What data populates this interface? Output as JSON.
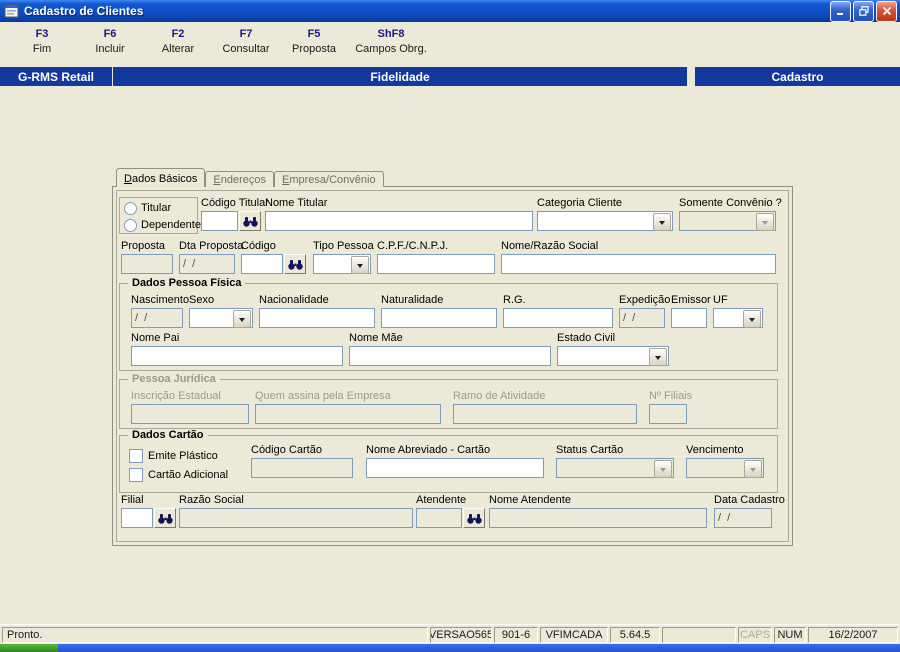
{
  "window": {
    "title": "Cadastro de Clientes"
  },
  "colors": {
    "titlebar_blue": "#0d4ec8",
    "banner_blue": "#15389e",
    "workspace_grey": "#ece9d8",
    "field_border_blue": "#7f9db9",
    "disabled_text": "#9d9a87",
    "taskbar_blue": "#2450c8",
    "start_green": "#3c9a2a"
  },
  "icons": {
    "app": "form-window-icon",
    "search": "binoculars-icon",
    "dropdown": "chevron-down-icon",
    "minimize": "minimize-icon",
    "restore": "restore-icon",
    "close": "close-icon"
  },
  "toolbar": {
    "items": [
      {
        "key": "F3",
        "label": "Fim"
      },
      {
        "key": "F6",
        "label": "Incluir"
      },
      {
        "key": "F2",
        "label": "Alterar"
      },
      {
        "key": "F7",
        "label": "Consultar"
      },
      {
        "key": "F5",
        "label": "Proposta"
      },
      {
        "key": "ShF8",
        "label": "Campos Obrg."
      }
    ]
  },
  "banner": {
    "left": "G-RMS Retail",
    "center": "Fidelidade",
    "right": "Cadastro"
  },
  "tabs": [
    {
      "accel": "D",
      "rest": "ados Básicos",
      "active": true
    },
    {
      "accel": "E",
      "rest": "ndereços",
      "active": false
    },
    {
      "accel": "E",
      "rest": "mpresa/Convênio",
      "active": false
    }
  ],
  "form": {
    "titular": "Titular",
    "dependente": "Dependente",
    "codigo_titular": "Código Titular",
    "nome_titular": "Nome Titular",
    "categoria_cliente": "Categoria Cliente",
    "somente_convenio": "Somente Convênio ?",
    "proposta": "Proposta",
    "dta_proposta": "Dta Proposta",
    "dta_proposta_value": "/  /",
    "codigo": "Código",
    "tipo_pessoa": "Tipo Pessoa",
    "cpf_cnpj": "C.P.F./C.N.P.J.",
    "nome_razao_social": "Nome/Razão Social",
    "grupo_pessoa_fisica": "Dados Pessoa Física",
    "nascimento": "Nascimento",
    "nascimento_value": "/  /",
    "sexo": "Sexo",
    "nacionalidade": "Nacionalidade",
    "naturalidade": "Naturalidade",
    "rg": "R.G.",
    "expedicao": "Expedição",
    "expedicao_value": "/  /",
    "emissor": "Emissor",
    "uf": "UF",
    "nome_pai": "Nome Pai",
    "nome_mae": "Nome Mãe",
    "estado_civil": "Estado Civil",
    "grupo_pessoa_juridica": "Pessoa Jurídica",
    "inscricao_estadual": "Inscrição Estadual",
    "quem_assina": "Quem assina pela Empresa",
    "ramo_atividade": "Ramo de Atividade",
    "num_filiais": "Nº Filiais",
    "grupo_cartao": "Dados Cartão",
    "emite_plastico": "Emite Plástico",
    "cartao_adicional": "Cartão Adicional",
    "codigo_cartao": "Código Cartão",
    "nome_abreviado_cartao": "Nome Abreviado - Cartão",
    "status_cartao": "Status Cartão",
    "vencimento": "Vencimento",
    "filial": "Filial",
    "razao_social": "Razão Social",
    "atendente": "Atendente",
    "nome_atendente": "Nome Atendente",
    "data_cadastro": "Data Cadastro",
    "data_cadastro_value": "/  /"
  },
  "statusbar": {
    "message": "Pronto.",
    "version": "VERSAO565",
    "terminal": "901-6",
    "program": "VFIMCADA",
    "build": "5.64.5",
    "spare": "",
    "caps": "CAPS",
    "num": "NUM",
    "date": "16/2/2007"
  }
}
